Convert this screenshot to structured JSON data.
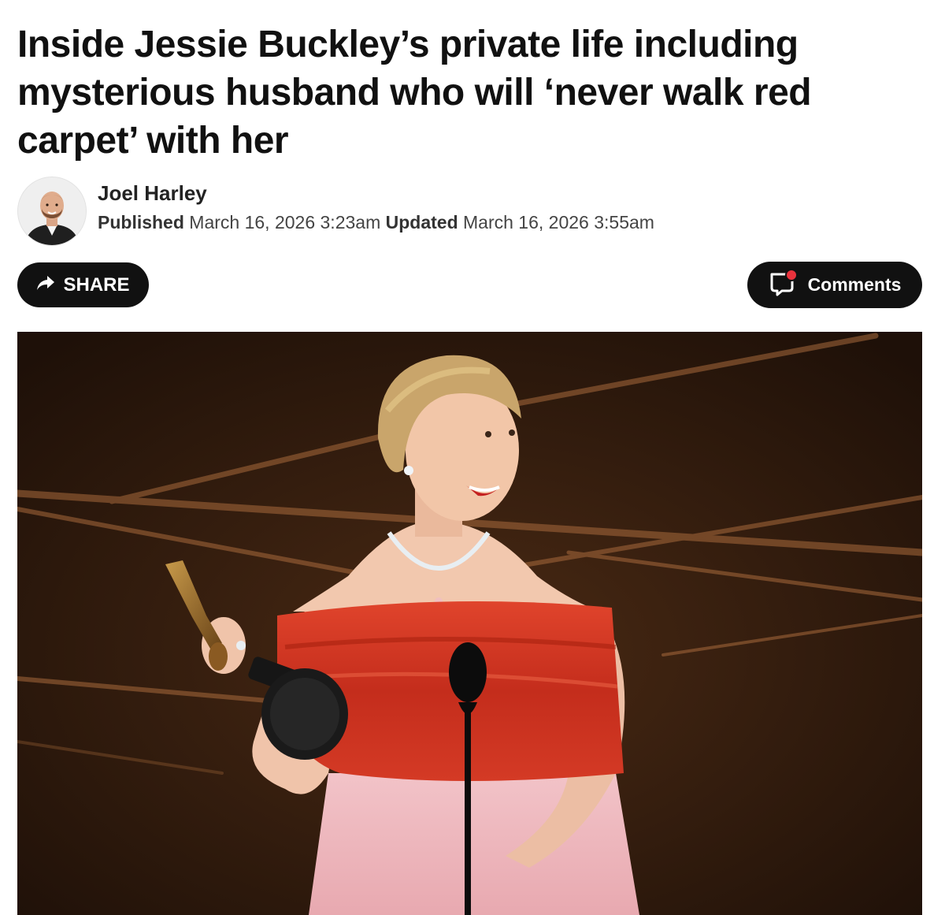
{
  "article": {
    "headline": "Inside Jessie Buckley’s private life including mysterious husband who will ‘never walk red carpet’ with her",
    "author": {
      "name": "Joel Harley",
      "avatar_icon": "author-avatar"
    },
    "published_label": "Published",
    "published_date": "March 16, 2026 3:23am",
    "updated_label": "Updated",
    "updated_date": "March 16, 2026 3:55am"
  },
  "actions": {
    "share_label": "SHARE",
    "share_icon": "share-arrow-icon",
    "comments_label": "Comments",
    "comments_icon": "comment-bubble-icon",
    "comments_indicator_color": "#e8323c"
  },
  "hero_image": {
    "icon": "hero-photo"
  },
  "colors": {
    "button_bg": "#111111",
    "button_text": "#ffffff",
    "headline": "#111111",
    "stage_bg": "#2a170c",
    "stage_light": "#a86a3c"
  }
}
